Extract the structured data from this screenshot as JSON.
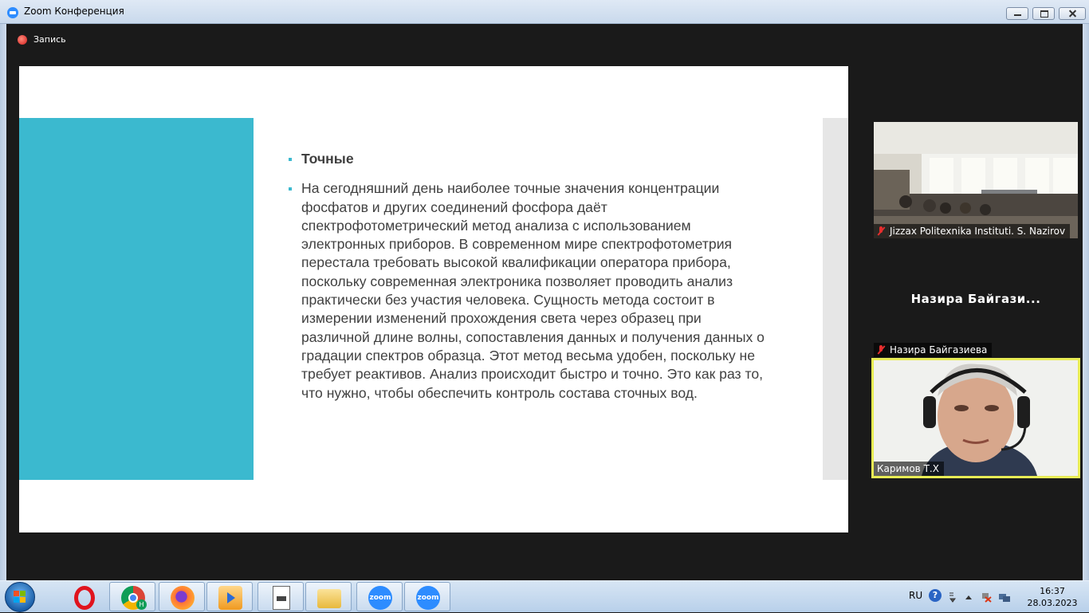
{
  "window": {
    "title": "Zoom Конференция"
  },
  "recording": {
    "label": "Запись"
  },
  "slide": {
    "bullets": [
      "Точные",
      "На сегодняшний день наиболее точные значения концентрации фосфатов и других соединений фосфора даёт спектрофотометрический метод анализа с использованием электронных приборов. В современном мире спектрофотометрия перестала требовать высокой квалификации оператора прибора, поскольку современная электроника позволяет проводить анализ практически без участия человека. Сущность метода состоит в измерении изменений прохождения света через образец при различной длине волны, сопоставления данных и получения данных о градации спектров образца. Этот метод весьма удобен, поскольку не требует реактивов. Анализ происходит быстро и точно. Это как раз то, что нужно, чтобы обеспечить контроль состава сточных вод."
    ],
    "accent_color": "#3bb9cf"
  },
  "participants": [
    {
      "name": "Jizzax Politexnika Instituti. S. Nazirov",
      "muted": true
    },
    {
      "name": "Назира Байгазиева",
      "display_name": "Назира Байгази...",
      "muted": true
    },
    {
      "name": "Каримов Т.Х",
      "muted": false,
      "active_speaker": true
    }
  ],
  "taskbar": {
    "apps": [
      "opera-icon",
      "chrome-icon",
      "firefox-icon",
      "media-player-icon",
      "document-icon",
      "explorer-icon",
      "zoom-icon",
      "zoom-icon"
    ],
    "zoom_label": "zoom",
    "chrome_badge": "H",
    "language": "RU",
    "help": "?",
    "time": "16:37",
    "date": "28.03.2023"
  }
}
